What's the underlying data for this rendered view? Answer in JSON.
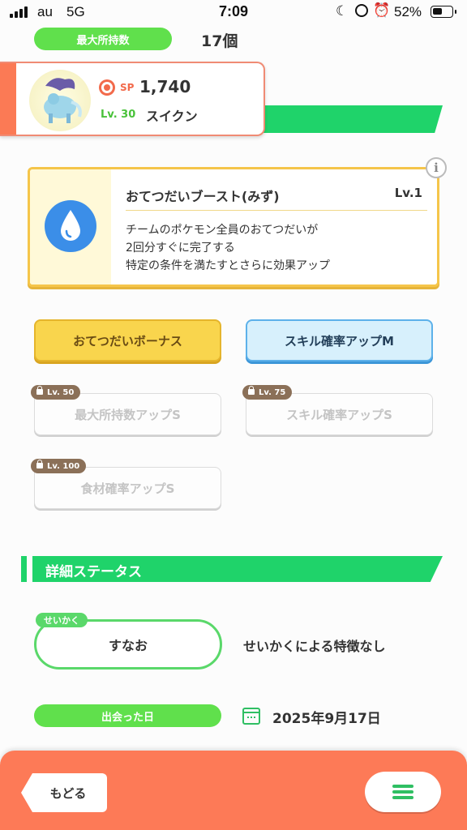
{
  "status_bar": {
    "carrier": "au",
    "network": "5G",
    "time": "7:09",
    "battery": "52%",
    "battery_level": 0.52
  },
  "header": {
    "max_carry_label": "最大所持数",
    "max_carry_value": "17個"
  },
  "pokemon": {
    "sp_label": "SP",
    "sp_value": "1,740",
    "level": "Lv. 30",
    "name": "スイクン"
  },
  "main_skill": {
    "name": "おてつだいブースト(みず)",
    "level": "Lv.1",
    "description": [
      "チームのポケモン全員のおてつだいが",
      "2回分すぐに完了する",
      "特定の条件を満たすとさらに効果アップ"
    ],
    "info_icon": "i"
  },
  "sub_skills": [
    {
      "label": "おてつだいボーナス",
      "unlocked": true,
      "color": "#f9d54d"
    },
    {
      "label": "スキル確率アップM",
      "unlocked": true,
      "color": "#d7f0fc"
    },
    {
      "label": "最大所持数アップS",
      "unlocked": false,
      "unlock_level": "Lv. 50"
    },
    {
      "label": "スキル確率アップS",
      "unlocked": false,
      "unlock_level": "Lv. 75"
    },
    {
      "label": "食材確率アップS",
      "unlocked": false,
      "unlock_level": "Lv. 100"
    }
  ],
  "details": {
    "section_title": "詳細ステータス",
    "nature_label": "せいかく",
    "nature_value": "すなお",
    "nature_note": "せいかくによる特徴なし",
    "met_label": "出会った日",
    "met_date": "2025年9月17日"
  },
  "bottom_bar": {
    "back_label": "もどる",
    "menu_icon": "hamburger-icon"
  },
  "colors": {
    "accent_green": "#1fd36a",
    "pill_green": "#60e04c",
    "bottom_bar": "#fd7a57",
    "water": "#3b8ee8"
  }
}
